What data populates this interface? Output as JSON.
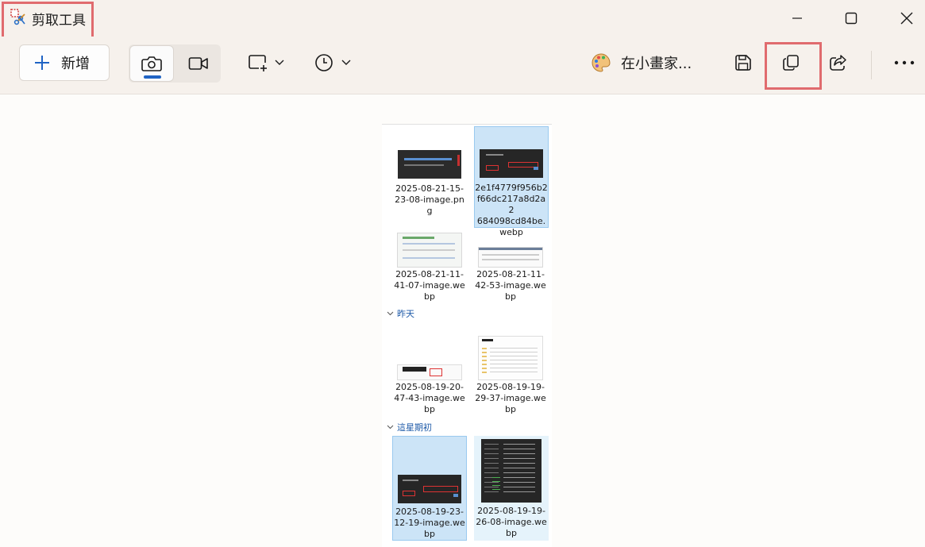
{
  "window": {
    "title": "剪取工具",
    "minimize_icon": "minimize-icon",
    "maximize_icon": "maximize-icon",
    "close_icon": "close-icon"
  },
  "toolbar": {
    "new_label": "新增",
    "mode_options": [
      "camera-icon",
      "video-camera-icon"
    ],
    "selected_mode": "camera-icon",
    "snip_shape_icon": "rectangle-snip-icon",
    "delay_icon": "clock-icon",
    "edit_in_paint_label": "在小畫家...",
    "save_icon": "save-icon",
    "copy_icon": "copy-icon",
    "share_icon": "share-icon",
    "more_icon": "more-icon"
  },
  "explorer": {
    "groups": [
      {
        "label": "",
        "files": [
          {
            "name": "2025-08-21-15-23-08-image.png",
            "lines": [
              "2025-08-21-15-",
              "23-08-image.pn",
              "g"
            ],
            "selected": false
          },
          {
            "name": "2e1f4779f956b2f66dc217a8d2a2684098cd84be.webp",
            "lines": [
              "2e1f4779f956b2",
              "f66dc217a8d2a2",
              "684098cd84be.",
              "webp"
            ],
            "selected": true
          },
          {
            "name": "2025-08-21-11-41-07-image.webp",
            "lines": [
              "2025-08-21-11-",
              "41-07-image.we",
              "bp"
            ],
            "selected": false
          },
          {
            "name": "2025-08-21-11-42-53-image.webp",
            "lines": [
              "2025-08-21-11-",
              "42-53-image.we",
              "bp"
            ],
            "selected": false
          }
        ]
      },
      {
        "label": "昨天",
        "files": [
          {
            "name": "2025-08-19-20-47-43-image.webp",
            "lines": [
              "2025-08-19-20-",
              "47-43-image.we",
              "bp"
            ],
            "selected": false
          },
          {
            "name": "2025-08-19-19-29-37-image.webp",
            "lines": [
              "2025-08-19-19-",
              "29-37-image.we",
              "bp"
            ],
            "selected": false
          }
        ]
      },
      {
        "label": "這星期初",
        "files": [
          {
            "name": "2025-08-19-23-12-19-image.webp",
            "lines": [
              "2025-08-19-23-",
              "12-19-image.we",
              "bp"
            ],
            "selected": true
          },
          {
            "name": "2025-08-19-19-26-08-image.webp",
            "lines": [
              "2025-08-19-19-",
              "26-08-image.we",
              "bp"
            ],
            "selected": false
          }
        ]
      }
    ]
  },
  "colors": {
    "accent": "#1f63c4",
    "highlight_box": "#e06b6e",
    "selection": "#cce4f7"
  }
}
